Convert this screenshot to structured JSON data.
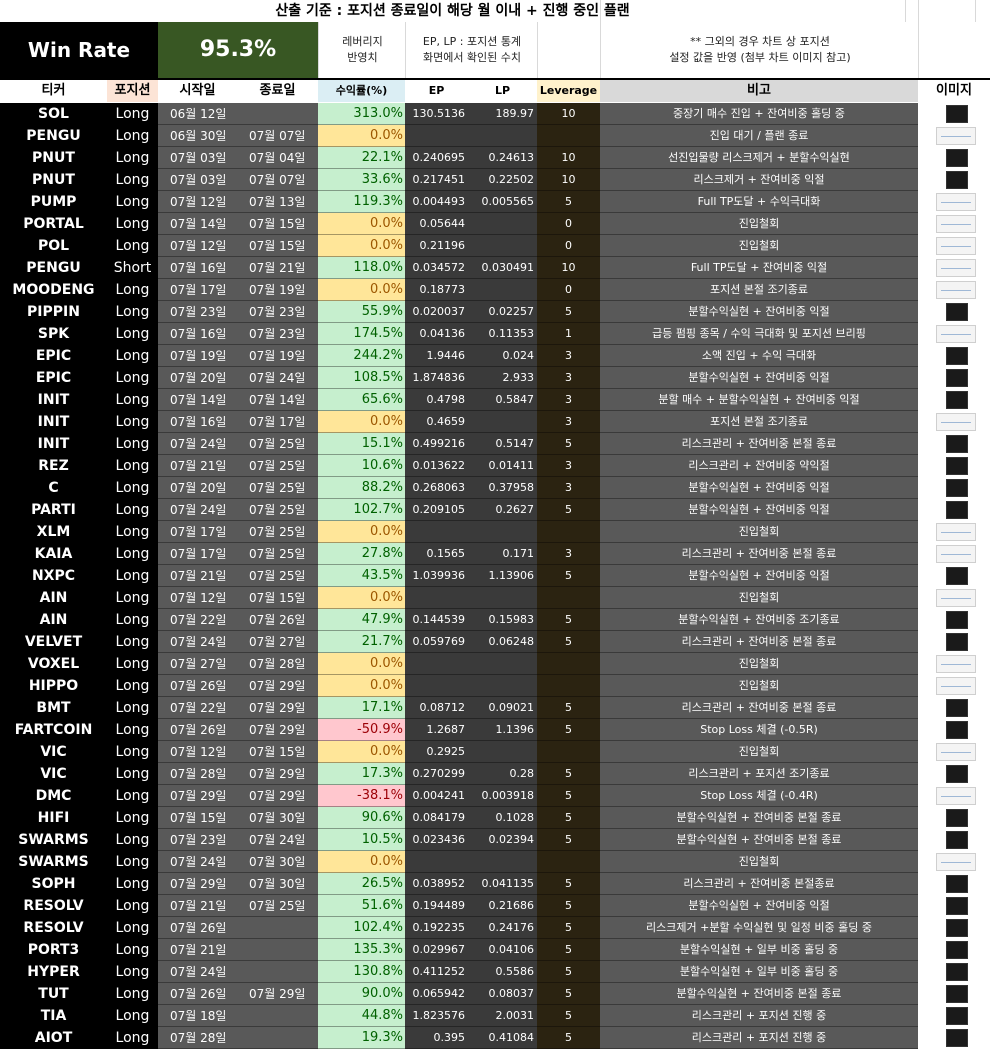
{
  "title": "산출 기준 : 포지션 종료일이 해당 월 이내 + 진행 중인 플랜",
  "win_rate": {
    "label": "Win Rate",
    "value": "95.3%"
  },
  "notes": {
    "leverage_note": "레버리지\n반영치",
    "price_note": "EP, LP : 포지션 통계\n화면에서 확인된 수치",
    "chart_note": "** 그외의 경우 차트 상 포지션\n설정 값을 반영 (첨부 차트 이미지 참고)"
  },
  "headers": {
    "ticker": "티커",
    "position": "포지션",
    "start": "시작일",
    "end": "종료일",
    "return": "수익률(%)",
    "ep": "EP",
    "lp": "LP",
    "leverage": "Leverage",
    "remark": "비고",
    "image": "이미지"
  },
  "colors": {
    "win": "#c6efce",
    "zero": "#ffe699",
    "loss": "#ffc7ce",
    "win_text": "#006100",
    "zero_text": "#9c5700",
    "loss_text": "#9c0006",
    "return_header_bg": "#dbeef4",
    "leverage_header_bg": "#fff2cc",
    "position_header_bg": "#fce4d6"
  },
  "rows": [
    {
      "ticker": "SOL",
      "position": "Long",
      "start": "06월 12일",
      "end": "",
      "ret": "313.0%",
      "status": "win",
      "ep": "130.5136",
      "lp": "189.97",
      "lev": "10",
      "note": "중장기 매수 진입 + 잔여비중 홀딩 중",
      "img": "dark"
    },
    {
      "ticker": "PENGU",
      "position": "Long",
      "start": "06월 30일",
      "end": "07월 07일",
      "ret": "0.0%",
      "status": "zero",
      "ep": "",
      "lp": "",
      "lev": "",
      "note": "진입 대기 / 플랜 종료",
      "img": "light"
    },
    {
      "ticker": "PNUT",
      "position": "Long",
      "start": "07월 03일",
      "end": "07월 04일",
      "ret": "22.1%",
      "status": "win",
      "ep": "0.240695",
      "lp": "0.24613",
      "lev": "10",
      "note": "선진입물량 리스크제거 + 분할수익실현",
      "img": "dark"
    },
    {
      "ticker": "PNUT",
      "position": "Long",
      "start": "07월 03일",
      "end": "07월 07일",
      "ret": "33.6%",
      "status": "win",
      "ep": "0.217451",
      "lp": "0.22502",
      "lev": "10",
      "note": "리스크제거 + 잔여비중 익절",
      "img": "dark"
    },
    {
      "ticker": "PUMP",
      "position": "Long",
      "start": "07월 12일",
      "end": "07월 13일",
      "ret": "119.3%",
      "status": "win",
      "ep": "0.004493",
      "lp": "0.005565",
      "lev": "5",
      "note": "Full TP도달 + 수익극대화",
      "img": "light"
    },
    {
      "ticker": "PORTAL",
      "position": "Long",
      "start": "07월 14일",
      "end": "07월 15일",
      "ret": "0.0%",
      "status": "zero",
      "ep": "0.05644",
      "lp": "",
      "lev": "0",
      "note": "진입철회",
      "img": "light"
    },
    {
      "ticker": "POL",
      "position": "Long",
      "start": "07월 12일",
      "end": "07월 15일",
      "ret": "0.0%",
      "status": "zero",
      "ep": "0.21196",
      "lp": "",
      "lev": "0",
      "note": "진입철회",
      "img": "light"
    },
    {
      "ticker": "PENGU",
      "position": "Short",
      "start": "07월 16일",
      "end": "07월 21일",
      "ret": "118.0%",
      "status": "win",
      "ep": "0.034572",
      "lp": "0.030491",
      "lev": "10",
      "note": "Full TP도달 + 잔여비중 익절",
      "img": "light"
    },
    {
      "ticker": "MOODENG",
      "position": "Long",
      "start": "07월 17일",
      "end": "07월 19일",
      "ret": "0.0%",
      "status": "zero",
      "ep": "0.18773",
      "lp": "",
      "lev": "0",
      "note": "포지션 본절 조기종료",
      "img": "light"
    },
    {
      "ticker": "PIPPIN",
      "position": "Long",
      "start": "07월 23일",
      "end": "07월 23일",
      "ret": "55.9%",
      "status": "win",
      "ep": "0.020037",
      "lp": "0.02257",
      "lev": "5",
      "note": "분할수익실현 + 잔여비중 익절",
      "img": "dark"
    },
    {
      "ticker": "SPK",
      "position": "Long",
      "start": "07월 16일",
      "end": "07월 23일",
      "ret": "174.5%",
      "status": "win",
      "ep": "0.04136",
      "lp": "0.11353",
      "lev": "1",
      "note": "급등 펌핑 종목 / 수익 극대화 및 포지션 브리핑",
      "img": "light"
    },
    {
      "ticker": "EPIC",
      "position": "Long",
      "start": "07월 19일",
      "end": "07월 19일",
      "ret": "244.2%",
      "status": "win",
      "ep": "1.9446",
      "lp": "0.024",
      "lev": "3",
      "note": "소액 진입 + 수익 극대화",
      "img": "dark"
    },
    {
      "ticker": "EPIC",
      "position": "Long",
      "start": "07월 20일",
      "end": "07월 24일",
      "ret": "108.5%",
      "status": "win",
      "ep": "1.874836",
      "lp": "2.933",
      "lev": "3",
      "note": "분할수익실현 + 잔여비중 익절",
      "img": "dark"
    },
    {
      "ticker": "INIT",
      "position": "Long",
      "start": "07월 14일",
      "end": "07월 14일",
      "ret": "65.6%",
      "status": "win",
      "ep": "0.4798",
      "lp": "0.5847",
      "lev": "3",
      "note": "분할 매수 + 분할수익실현 + 잔여비중 익절",
      "img": "dark"
    },
    {
      "ticker": "INIT",
      "position": "Long",
      "start": "07월 16일",
      "end": "07월 17일",
      "ret": "0.0%",
      "status": "zero",
      "ep": "0.4659",
      "lp": "",
      "lev": "3",
      "note": "포지션 본절 조기종료",
      "img": "light"
    },
    {
      "ticker": "INIT",
      "position": "Long",
      "start": "07월 24일",
      "end": "07월 25일",
      "ret": "15.1%",
      "status": "win",
      "ep": "0.499216",
      "lp": "0.5147",
      "lev": "5",
      "note": "리스크관리 + 잔여비중 본절 종료",
      "img": "dark"
    },
    {
      "ticker": "REZ",
      "position": "Long",
      "start": "07월 21일",
      "end": "07월 25일",
      "ret": "10.6%",
      "status": "win",
      "ep": "0.013622",
      "lp": "0.01411",
      "lev": "3",
      "note": "리스크관리 + 잔여비중 약익절",
      "img": "dark"
    },
    {
      "ticker": "C",
      "position": "Long",
      "start": "07월 20일",
      "end": "07월 25일",
      "ret": "88.2%",
      "status": "win",
      "ep": "0.268063",
      "lp": "0.37958",
      "lev": "3",
      "note": "분할수익실현 + 잔여비중 익절",
      "img": "dark"
    },
    {
      "ticker": "PARTI",
      "position": "Long",
      "start": "07월 24일",
      "end": "07월 25일",
      "ret": "102.7%",
      "status": "win",
      "ep": "0.209105",
      "lp": "0.2627",
      "lev": "5",
      "note": "분할수익실현 + 잔여비중 익절",
      "img": "dark"
    },
    {
      "ticker": "XLM",
      "position": "Long",
      "start": "07월 17일",
      "end": "07월 25일",
      "ret": "0.0%",
      "status": "zero",
      "ep": "",
      "lp": "",
      "lev": "",
      "note": "진입철회",
      "img": "light"
    },
    {
      "ticker": "KAIA",
      "position": "Long",
      "start": "07월 17일",
      "end": "07월 25일",
      "ret": "27.8%",
      "status": "win",
      "ep": "0.1565",
      "lp": "0.171",
      "lev": "3",
      "note": "리스크관리 + 잔여비중 본절 종료",
      "img": "light"
    },
    {
      "ticker": "NXPC",
      "position": "Long",
      "start": "07월 21일",
      "end": "07월 25일",
      "ret": "43.5%",
      "status": "win",
      "ep": "1.039936",
      "lp": "1.13906",
      "lev": "5",
      "note": "분할수익실현 + 잔여비중 익절",
      "img": "dark"
    },
    {
      "ticker": "AIN",
      "position": "Long",
      "start": "07월 12일",
      "end": "07월 15일",
      "ret": "0.0%",
      "status": "zero",
      "ep": "",
      "lp": "",
      "lev": "",
      "note": "진입철회",
      "img": "light"
    },
    {
      "ticker": "AIN",
      "position": "Long",
      "start": "07월 22일",
      "end": "07월 26일",
      "ret": "47.9%",
      "status": "win",
      "ep": "0.144539",
      "lp": "0.15983",
      "lev": "5",
      "note": "분할수익실현 + 잔여비중 조기종료",
      "img": "dark"
    },
    {
      "ticker": "VELVET",
      "position": "Long",
      "start": "07월 24일",
      "end": "07월 27일",
      "ret": "21.7%",
      "status": "win",
      "ep": "0.059769",
      "lp": "0.06248",
      "lev": "5",
      "note": "리스크관리 + 잔여비중 본절 종료",
      "img": "dark"
    },
    {
      "ticker": "VOXEL",
      "position": "Long",
      "start": "07월 27일",
      "end": "07월 28일",
      "ret": "0.0%",
      "status": "zero",
      "ep": "",
      "lp": "",
      "lev": "",
      "note": "진입철회",
      "img": "light"
    },
    {
      "ticker": "HIPPO",
      "position": "Long",
      "start": "07월 26일",
      "end": "07월 29일",
      "ret": "0.0%",
      "status": "zero",
      "ep": "",
      "lp": "",
      "lev": "",
      "note": "진입철회",
      "img": "light"
    },
    {
      "ticker": "BMT",
      "position": "Long",
      "start": "07월 22일",
      "end": "07월 29일",
      "ret": "17.1%",
      "status": "win",
      "ep": "0.08712",
      "lp": "0.09021",
      "lev": "5",
      "note": "리스크관리 + 잔여비중 본절 종료",
      "img": "dark"
    },
    {
      "ticker": "FARTCOIN",
      "position": "Long",
      "start": "07월 26일",
      "end": "07월 29일",
      "ret": "-50.9%",
      "status": "loss",
      "ep": "1.2687",
      "lp": "1.1396",
      "lev": "5",
      "note": "Stop Loss 체결 (-0.5R)",
      "img": "dark"
    },
    {
      "ticker": "VIC",
      "position": "Long",
      "start": "07월 12일",
      "end": "07월 15일",
      "ret": "0.0%",
      "status": "zero",
      "ep": "0.2925",
      "lp": "",
      "lev": "",
      "note": "진입철회",
      "img": "light"
    },
    {
      "ticker": "VIC",
      "position": "Long",
      "start": "07월 28일",
      "end": "07월 29일",
      "ret": "17.3%",
      "status": "win",
      "ep": "0.270299",
      "lp": "0.28",
      "lev": "5",
      "note": "리스크관리 + 포지션 조기종료",
      "img": "dark"
    },
    {
      "ticker": "DMC",
      "position": "Long",
      "start": "07월 29일",
      "end": "07월 29일",
      "ret": "-38.1%",
      "status": "loss",
      "ep": "0.004241",
      "lp": "0.003918",
      "lev": "5",
      "note": "Stop Loss 체결 (-0.4R)",
      "img": "light"
    },
    {
      "ticker": "HIFI",
      "position": "Long",
      "start": "07월 15일",
      "end": "07월 30일",
      "ret": "90.6%",
      "status": "win",
      "ep": "0.084179",
      "lp": "0.1028",
      "lev": "5",
      "note": "분할수익실현 + 잔여비중 본절 종료",
      "img": "dark"
    },
    {
      "ticker": "SWARMS",
      "position": "Long",
      "start": "07월 23일",
      "end": "07월 24일",
      "ret": "10.5%",
      "status": "win",
      "ep": "0.023436",
      "lp": "0.02394",
      "lev": "5",
      "note": "분할수익실현 + 잔여비중 본절 종료",
      "img": "dark"
    },
    {
      "ticker": "SWARMS",
      "position": "Long",
      "start": "07월 24일",
      "end": "07월 30일",
      "ret": "0.0%",
      "status": "zero",
      "ep": "",
      "lp": "",
      "lev": "",
      "note": "진입철회",
      "img": "light"
    },
    {
      "ticker": "SOPH",
      "position": "Long",
      "start": "07월 29일",
      "end": "07월 30일",
      "ret": "26.5%",
      "status": "win",
      "ep": "0.038952",
      "lp": "0.041135",
      "lev": "5",
      "note": "리스크관리 + 잔여비중 본절종료",
      "img": "dark"
    },
    {
      "ticker": "RESOLV",
      "position": "Long",
      "start": "07월 21일",
      "end": "07월 25일",
      "ret": "51.6%",
      "status": "win",
      "ep": "0.194489",
      "lp": "0.21686",
      "lev": "5",
      "note": "분할수익실현 + 잔여비중 익절",
      "img": "dark"
    },
    {
      "ticker": "RESOLV",
      "position": "Long",
      "start": "07월 26일",
      "end": "",
      "ret": "102.4%",
      "status": "win",
      "ep": "0.192235",
      "lp": "0.24176",
      "lev": "5",
      "note": "리스크제거 +분할 수익실현 및 일정 비중 홀딩 중",
      "img": "dark"
    },
    {
      "ticker": "PORT3",
      "position": "Long",
      "start": "07월 21일",
      "end": "",
      "ret": "135.3%",
      "status": "win",
      "ep": "0.029967",
      "lp": "0.04106",
      "lev": "5",
      "note": "분할수익실현 + 일부 비중 홀딩 중",
      "img": "dark"
    },
    {
      "ticker": "HYPER",
      "position": "Long",
      "start": "07월 24일",
      "end": "",
      "ret": "130.8%",
      "status": "win",
      "ep": "0.411252",
      "lp": "0.5586",
      "lev": "5",
      "note": "분할수익실현 + 일부 비중 홀딩 중",
      "img": "dark"
    },
    {
      "ticker": "TUT",
      "position": "Long",
      "start": "07월 26일",
      "end": "07월 29일",
      "ret": "90.0%",
      "status": "win",
      "ep": "0.065942",
      "lp": "0.08037",
      "lev": "5",
      "note": "분할수익실현 + 잔여비중 본절 종료",
      "img": "dark"
    },
    {
      "ticker": "TIA",
      "position": "Long",
      "start": "07월 18일",
      "end": "",
      "ret": "44.8%",
      "status": "win",
      "ep": "1.823576",
      "lp": "2.0031",
      "lev": "5",
      "note": "리스크관리 + 포지션 진행 중",
      "img": "dark"
    },
    {
      "ticker": "AIOT",
      "position": "Long",
      "start": "07월 28일",
      "end": "",
      "ret": "19.3%",
      "status": "win",
      "ep": "0.395",
      "lp": "0.41084",
      "lev": "5",
      "note": "리스크관리 + 포지션 진행 중",
      "img": "dark"
    }
  ]
}
